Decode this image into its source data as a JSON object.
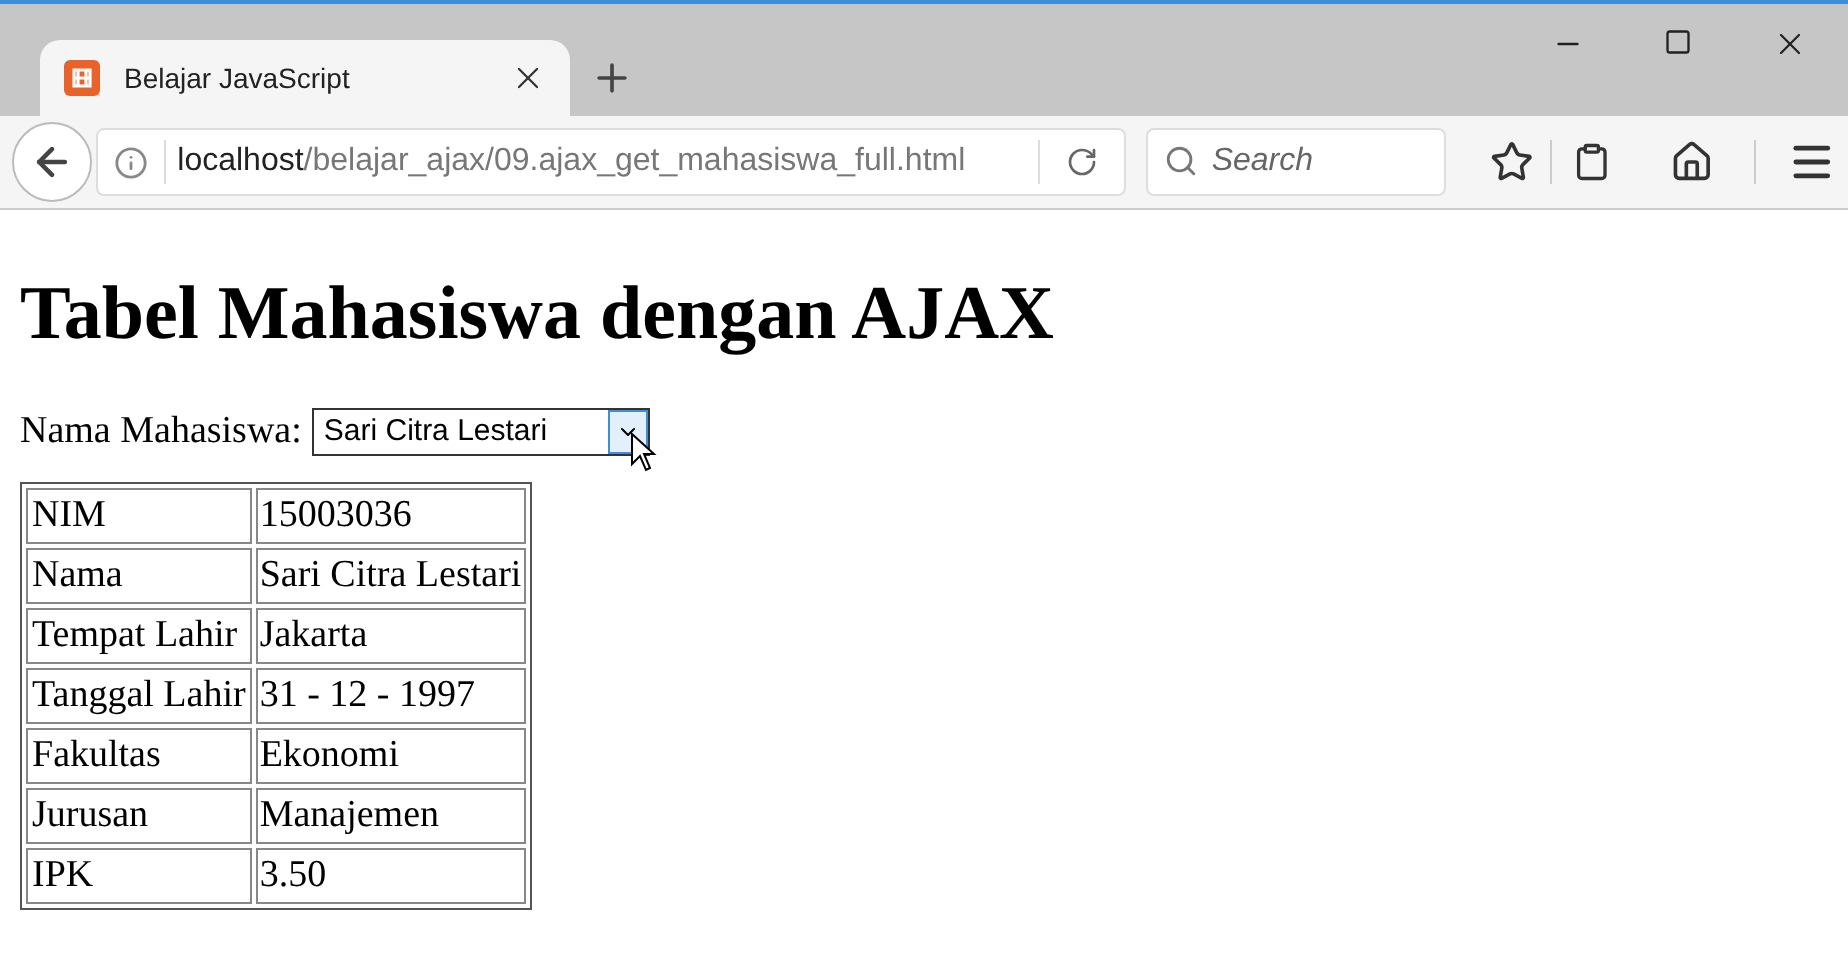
{
  "tab": {
    "title": "Belajar JavaScript",
    "selected": true
  },
  "address_bar": {
    "host": "localhost",
    "path": "/belajar_ajax/09.ajax_get_mahasiswa_full.html"
  },
  "search": {
    "placeholder": "Search"
  },
  "page": {
    "heading": "Tabel Mahasiswa dengan AJAX",
    "select_label": "Nama Mahasiswa:",
    "select_value": "Sari Citra Lestari",
    "table": {
      "rows": [
        {
          "label": "NIM",
          "value": "15003036"
        },
        {
          "label": "Nama",
          "value": "Sari Citra Lestari"
        },
        {
          "label": "Tempat Lahir",
          "value": "Jakarta"
        },
        {
          "label": "Tanggal Lahir",
          "value": "31 - 12 - 1997"
        },
        {
          "label": "Fakultas",
          "value": "Ekonomi"
        },
        {
          "label": "Jurusan",
          "value": "Manajemen"
        },
        {
          "label": "IPK",
          "value": "3.50"
        }
      ]
    }
  }
}
